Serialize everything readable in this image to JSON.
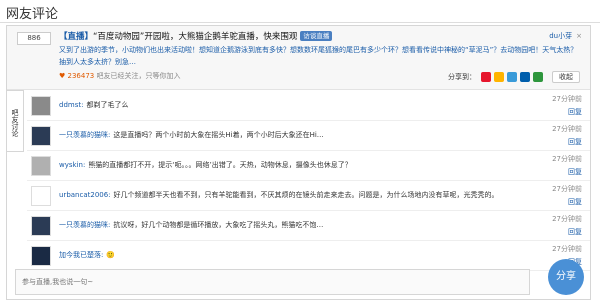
{
  "header": {
    "title": "网友评论"
  },
  "topic": {
    "count": "886",
    "title_live": "【直播】",
    "title_text": "“百度动物园”开园啦，大熊猫企鹅羊驼直播，快来围观",
    "badge": "访谈直播",
    "author": "du小芽",
    "close": "×",
    "desc": "又到了出游的季节，小动物们也出来活动啦！想知道企鹅游泳到底有多快？想数数环尾狐猴的尾巴有多少个环？想看看传说中神秘的“草泥马”？去动物园吧！天气太热？抽到人太多太挤？别急…",
    "stats_num": "236473",
    "stats_text": "吧友已经关注，只等你加入",
    "share_label": "分享到：",
    "collapse_label": "收起",
    "share_icons": [
      {
        "name": "sina-weibo-icon",
        "color": "#e6162d"
      },
      {
        "name": "qzone-icon",
        "color": "#ffb400"
      },
      {
        "name": "qq-weibo-icon",
        "color": "#3a9bd9"
      },
      {
        "name": "renren-icon",
        "color": "#005eac"
      },
      {
        "name": "douban-icon",
        "color": "#2e963d"
      }
    ]
  },
  "side_tab": {
    "label": "吧友讨论"
  },
  "comments": [
    {
      "user": "ddmst:",
      "content": "都剃了毛了么",
      "time": "27分钟前",
      "avatar": "#8a8a8a"
    },
    {
      "user": "一只羡慕的猫咪:",
      "content": "这是直播吗？两个小时前大象在摇头Hi着，两个小时后大象还在Hi…",
      "time": "27分钟前",
      "avatar": "#2b3b55"
    },
    {
      "user": "wyskin:",
      "content": "熊猫的直播都打不开，提示‘呃。。。网络’出错了。天热，动物休息，摄像头也休息了？",
      "time": "27分钟前",
      "avatar": "#b0b0b0"
    },
    {
      "user": "urbancat2006:",
      "content": "好几个频道都半天也看不到，只有羊驼能看到，不厌其烦的在镜头前走来走去。问题是，为什么场地内没有草呢，光秃秃的。",
      "time": "27分钟前",
      "avatar": "#ffffff"
    },
    {
      "user": "一只羡慕的猫咪:",
      "content": "抗议呀，好几个动物都是循环播放，大象吃了摇头丸，熊猫吃不饱…",
      "time": "27分钟前",
      "avatar": "#2b3b55"
    },
    {
      "user": "加今我已楚落:",
      "content": "🙂",
      "time": "27分钟前",
      "avatar": "#1a2a44"
    }
  ],
  "reply_label": "回复",
  "input": {
    "placeholder": "参与直播,我也说一句~"
  },
  "share_fab": {
    "label": "分享"
  }
}
